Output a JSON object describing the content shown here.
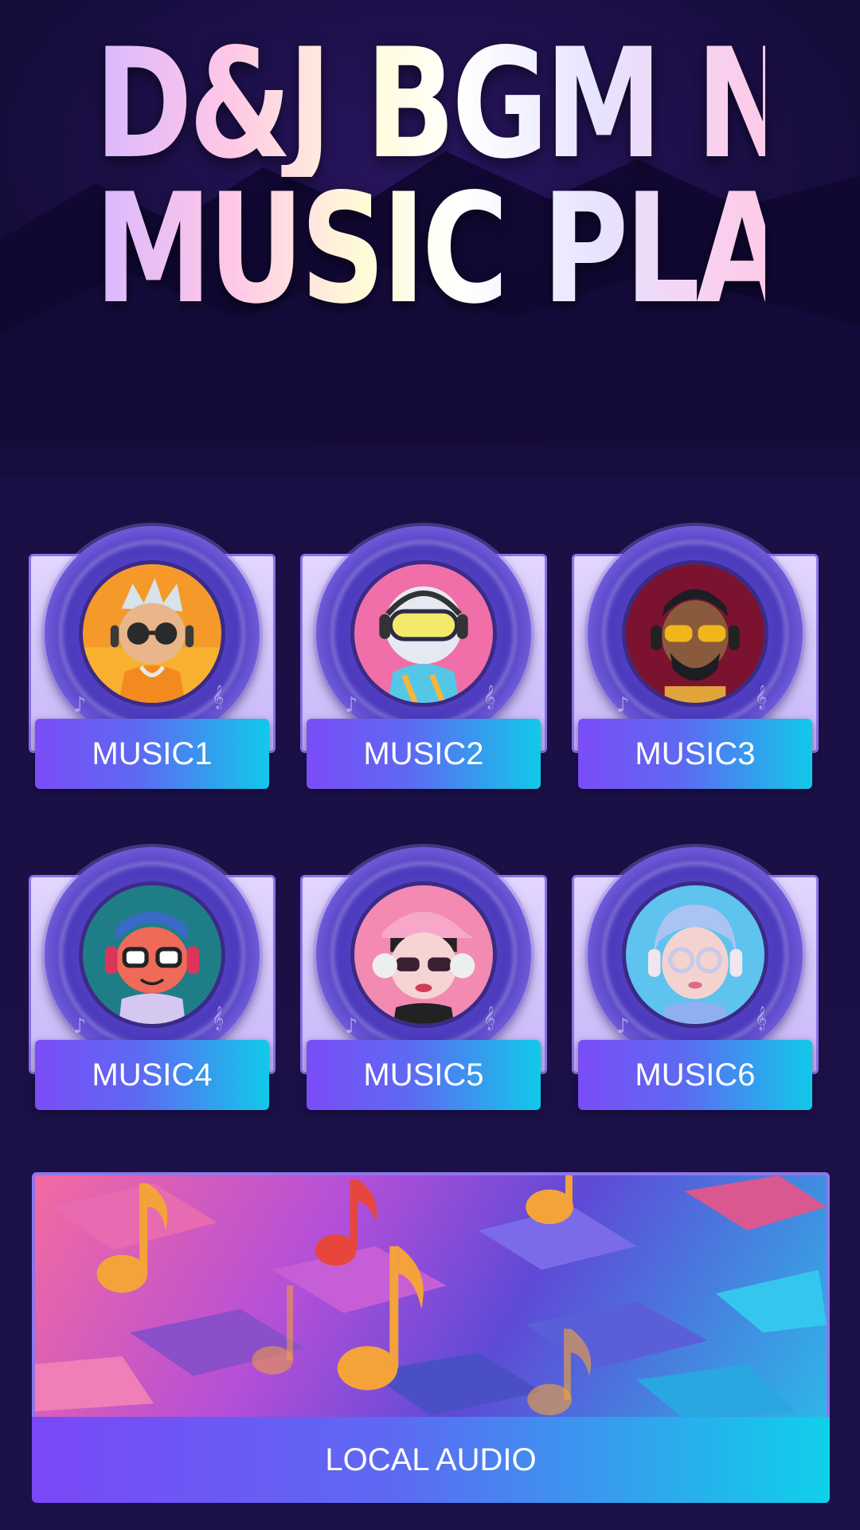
{
  "header": {
    "title_line1": "D&J BGM NOTES",
    "title_line2": "MUSIC PLAYER"
  },
  "music_items": [
    {
      "label": "MUSIC1",
      "avatar": "dj-avatar-orange-hoodie-sunglasses"
    },
    {
      "label": "MUSIC2",
      "avatar": "dj-avatar-robot-goggles"
    },
    {
      "label": "MUSIC3",
      "avatar": "dj-avatar-beard-gold-glasses"
    },
    {
      "label": "MUSIC4",
      "avatar": "dj-avatar-red-glasses-headphones"
    },
    {
      "label": "MUSIC5",
      "avatar": "dj-avatar-pink-cap-sunglasses"
    },
    {
      "label": "MUSIC6",
      "avatar": "dj-avatar-blue-hair-glasses"
    }
  ],
  "local_audio": {
    "label": "LOCAL AUDIO",
    "image": "music-notes-3d-artwork"
  },
  "colors": {
    "background": "#1a1045",
    "button_gradient_start": "#7a48f7",
    "button_gradient_end": "#0fd0ea",
    "card_border": "#8c72e9"
  }
}
